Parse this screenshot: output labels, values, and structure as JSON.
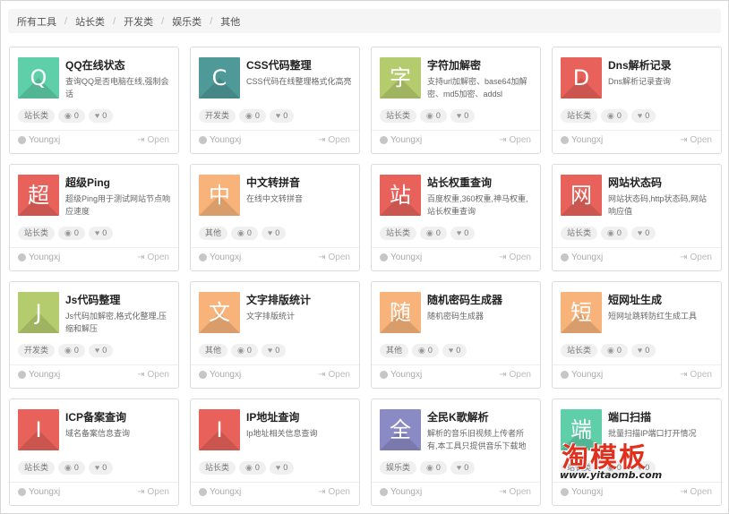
{
  "breadcrumb": {
    "items": [
      "所有工具",
      "站长类",
      "开发类",
      "娱乐类",
      "其他"
    ],
    "separator": "/"
  },
  "icons": {
    "views": "eye-icon",
    "likes": "heart-icon",
    "author": "user-icon",
    "open": "sign-in-icon"
  },
  "cards": [
    {
      "glyph": "Q",
      "color": "#5fcfa9",
      "title": "QQ在线状态",
      "desc": "查询QQ是否电脑在线,强制会话",
      "category": "站长类",
      "views": "0",
      "likes": "0",
      "author": "Youngxj",
      "open": "Open"
    },
    {
      "glyph": "C",
      "color": "#4f9999",
      "title": "CSS代码整理",
      "desc": "CSS代码在线整理格式化高亮",
      "category": "开发类",
      "views": "0",
      "likes": "0",
      "author": "Youngxj",
      "open": "Open"
    },
    {
      "glyph": "字",
      "color": "#b5cc6e",
      "title": "字符加解密",
      "desc": "支持url加解密、base64加解密、md5加密、addsl",
      "category": "站长类",
      "views": "0",
      "likes": "0",
      "author": "Youngxj",
      "open": "Open"
    },
    {
      "glyph": "D",
      "color": "#e8615a",
      "title": "Dns解析记录",
      "desc": "Dns解析记录查询",
      "category": "站长类",
      "views": "0",
      "likes": "0",
      "author": "Youngxj",
      "open": "Open"
    },
    {
      "glyph": "超",
      "color": "#e8615a",
      "title": "超级Ping",
      "desc": "超级Ping用于测试网站节点响应速度",
      "category": "站长类",
      "views": "0",
      "likes": "0",
      "author": "Youngxj",
      "open": "Open"
    },
    {
      "glyph": "中",
      "color": "#f7b37a",
      "title": "中文转拼音",
      "desc": "在线中文转拼音",
      "category": "其他",
      "views": "0",
      "likes": "0",
      "author": "Youngxj",
      "open": "Open"
    },
    {
      "glyph": "站",
      "color": "#e8615a",
      "title": "站长权重查询",
      "desc": "百度权重,360权重,神马权重,站长权重查询",
      "category": "站长类",
      "views": "0",
      "likes": "0",
      "author": "Youngxj",
      "open": "Open"
    },
    {
      "glyph": "网",
      "color": "#e8615a",
      "title": "网站状态码",
      "desc": "网站状态码,http状态码,网站响应值",
      "category": "站长类",
      "views": "0",
      "likes": "0",
      "author": "Youngxj",
      "open": "Open"
    },
    {
      "glyph": "J",
      "color": "#b5cc6e",
      "title": "Js代码整理",
      "desc": "Js代码加解密,格式化整理,压缩和解压",
      "category": "开发类",
      "views": "0",
      "likes": "0",
      "author": "Youngxj",
      "open": "Open"
    },
    {
      "glyph": "文",
      "color": "#f7b37a",
      "title": "文字排版统计",
      "desc": "文字排版统计",
      "category": "其他",
      "views": "0",
      "likes": "0",
      "author": "Youngxj",
      "open": "Open"
    },
    {
      "glyph": "随",
      "color": "#f7b37a",
      "title": "随机密码生成器",
      "desc": "随机密码生成器",
      "category": "其他",
      "views": "0",
      "likes": "0",
      "author": "Youngxj",
      "open": "Open"
    },
    {
      "glyph": "短",
      "color": "#f7b37a",
      "title": "短网址生成",
      "desc": "短网址跳转防红生成工具",
      "category": "站长类",
      "views": "0",
      "likes": "0",
      "author": "Youngxj",
      "open": "Open"
    },
    {
      "glyph": "I",
      "color": "#e8615a",
      "title": "ICP备案查询",
      "desc": "域名备案信息查询",
      "category": "站长类",
      "views": "0",
      "likes": "0",
      "author": "Youngxj",
      "open": "Open"
    },
    {
      "glyph": "I",
      "color": "#e8615a",
      "title": "IP地址查询",
      "desc": "Ip地址相关信息查询",
      "category": "站长类",
      "views": "0",
      "likes": "0",
      "author": "Youngxj",
      "open": "Open"
    },
    {
      "glyph": "全",
      "color": "#8a8ac4",
      "title": "全民K歌解析",
      "desc": "解析的音乐旧视频上传者所有,本工具只提供音乐下载地",
      "category": "娱乐类",
      "views": "0",
      "likes": "0",
      "author": "Youngxj",
      "open": "Open"
    },
    {
      "glyph": "端",
      "color": "#5fcfa9",
      "title": "端口扫描",
      "desc": "批量扫描IP端口打开情况",
      "category": "站长类",
      "views": "0",
      "likes": "0",
      "author": "Youngxj",
      "open": "Open"
    }
  ],
  "watermark": {
    "main": "淘模板",
    "sub": "www.yitaomb.com"
  }
}
